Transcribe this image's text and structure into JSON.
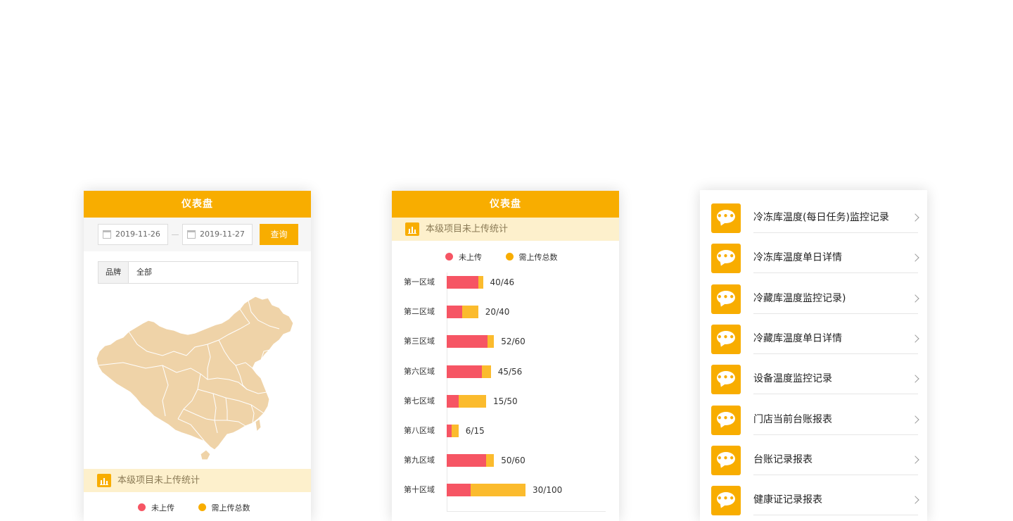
{
  "colors": {
    "accent": "#f8ad00",
    "not_uploaded": "#f65564",
    "total_needed": "#fbbb2d",
    "section_bg": "#fdf0cc",
    "map_fill": "#efd3a8"
  },
  "panel1": {
    "header_title": "仪表盘",
    "date_start": "2019-11-26",
    "date_end": "2019-11-27",
    "query_button": "查询",
    "brand_label": "品牌",
    "brand_value": "全部",
    "section_title": "本级项目未上传统计",
    "legend": {
      "not_uploaded": "未上传",
      "total_needed": "需上传总数"
    }
  },
  "panel2": {
    "header_title": "仪表盘",
    "section_title": "本级项目未上传统计",
    "legend": {
      "not_uploaded": "未上传",
      "total_needed": "需上传总数"
    }
  },
  "chart_data": {
    "type": "bar",
    "orientation": "horizontal",
    "categories": [
      "第一区域",
      "第二区域",
      "第三区域",
      "第六区域",
      "第七区域",
      "第八区域",
      "第九区域",
      "第十区域"
    ],
    "series": [
      {
        "name": "未上传",
        "values": [
          40,
          20,
          52,
          45,
          15,
          6,
          50,
          30
        ]
      },
      {
        "name": "需上传总数",
        "values": [
          46,
          40,
          60,
          56,
          50,
          15,
          60,
          100
        ]
      }
    ],
    "value_labels": [
      "40/46",
      "20/40",
      "52/60",
      "45/56",
      "15/50",
      "6/15",
      "50/60",
      "30/100"
    ],
    "legend_position": "top"
  },
  "panel3": {
    "items": [
      {
        "title": "冷冻库温度(每日任务)监控记录",
        "icon": "chat-bubble-icon"
      },
      {
        "title": "冷冻库温度单日详情",
        "icon": "chat-bubble-icon"
      },
      {
        "title": "冷藏库温度监控记录)",
        "icon": "chat-bubble-icon"
      },
      {
        "title": "冷藏库温度单日详情",
        "icon": "chat-bubble-icon"
      },
      {
        "title": "设备温度监控记录",
        "icon": "chat-bubble-icon"
      },
      {
        "title": "门店当前台账报表",
        "icon": "chat-bubble-icon"
      },
      {
        "title": "台账记录报表",
        "icon": "chat-bubble-icon"
      },
      {
        "title": "健康证记录报表",
        "icon": "chat-bubble-icon"
      }
    ]
  }
}
